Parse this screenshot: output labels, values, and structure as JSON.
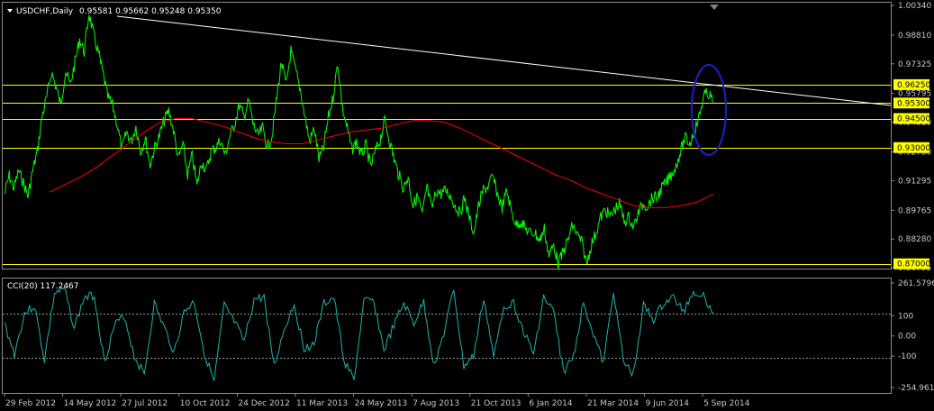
{
  "header": {
    "symbol": "USDCHF,Daily",
    "ohlc": "0.95581 0.95662 0.95248 0.95350"
  },
  "indicator": {
    "label": "CCI(20) 117.2467",
    "ticks": [
      "261.5796",
      "100",
      "0.00",
      "-100",
      "-254.9616"
    ]
  },
  "price_axis": {
    "ticks": [
      "1.00340",
      "0.98810",
      "0.97325",
      "0.95795",
      "0.94310",
      "0.92780",
      "0.91295",
      "0.89765",
      "0.88280",
      "0.86795"
    ],
    "tags": [
      "0.96250",
      "0.95300",
      "0.94500",
      "0.93000",
      "0.87000"
    ]
  },
  "time_axis": {
    "labels": [
      "29 Feb 2012",
      "14 May 2012",
      "27 Jul 2012",
      "10 Oct 2012",
      "24 Dec 2012",
      "11 Mar 2013",
      "24 May 2013",
      "7 Aug 2013",
      "21 Oct 2013",
      "6 Jan 2014",
      "21 Mar 2014",
      "9 Jun 2014",
      "5 Sep 2014"
    ]
  },
  "colors": {
    "background": "#000000",
    "price": "#00ff00",
    "ma": "#ff0000",
    "levels": "#ffff00",
    "trendline": "#ffffff",
    "cci": "#20b2aa",
    "ellipse": "#1e1ecd"
  },
  "chart_data": [
    {
      "type": "line",
      "series": [
        {
          "values": [
            0.906,
            0.9155,
            0.909,
            0.918,
            0.912,
            0.905,
            0.918,
            0.928,
            0.946,
            0.956,
            0.969,
            0.961,
            0.952,
            0.97,
            0.962,
            0.974,
            0.986,
            0.9795,
            0.9995,
            0.988,
            0.979,
            0.968,
            0.956,
            0.952,
            0.942,
            0.929,
            0.938,
            0.933,
            0.941,
            0.928,
            0.935,
            0.921,
            0.93,
            0.936,
            0.944,
            0.949,
            0.939,
            0.924,
            0.932,
            0.916,
            0.926,
            0.91,
            0.923,
            0.918,
            0.928,
            0.93,
            0.934,
            0.926,
            0.936,
            0.942,
            0.952,
            0.946,
            0.954,
            0.942,
            0.936,
            0.94,
            0.93,
            0.936,
            0.956,
            0.974,
            0.962,
            0.98,
            0.97,
            0.96,
            0.946,
            0.933,
            0.94,
            0.924,
            0.93,
            0.946,
            0.956,
            0.974,
            0.95,
            0.94,
            0.929,
            0.933,
            0.926,
            0.931,
            0.92,
            0.928,
            0.934,
            0.944,
            0.934,
            0.924,
            0.916,
            0.909,
            0.915,
            0.9,
            0.905,
            0.895,
            0.91,
            0.898,
            0.908,
            0.906,
            0.908,
            0.905,
            0.9,
            0.896,
            0.904,
            0.894,
            0.886,
            0.9,
            0.908,
            0.91,
            0.915,
            0.906,
            0.899,
            0.908,
            0.897,
            0.89,
            0.892,
            0.888,
            0.886,
            0.886,
            0.882,
            0.888,
            0.874,
            0.88,
            0.87,
            0.876,
            0.882,
            0.89,
            0.885,
            0.881,
            0.87,
            0.88,
            0.886,
            0.894,
            0.898,
            0.894,
            0.898,
            0.901,
            0.892,
            0.894,
            0.889,
            0.896,
            0.901,
            0.9,
            0.904,
            0.904,
            0.909,
            0.912,
            0.916,
            0.92,
            0.928,
            0.935,
            0.932,
            0.939,
            0.946,
            0.957,
            0.958,
            0.9535
          ]
        },
        {
          "values": [
            0.907,
            0.911,
            0.915,
            0.92,
            0.926,
            0.932,
            0.938,
            0.943,
            0.945,
            0.945,
            0.943,
            0.941,
            0.938,
            0.935,
            0.933,
            0.932,
            0.932,
            0.934,
            0.936,
            0.938,
            0.939,
            0.94,
            0.942,
            0.944,
            0.944,
            0.943,
            0.94,
            0.936,
            0.932,
            0.928,
            0.924,
            0.92,
            0.916,
            0.913,
            0.909,
            0.906,
            0.903,
            0.9,
            0.899,
            0.899,
            0.9,
            0.902,
            0.906
          ]
        }
      ],
      "levels": [
        0.9625,
        0.953,
        0.945,
        0.93,
        0.87
      ]
    },
    {
      "type": "line",
      "series": [
        {
          "name": "CCI(20)",
          "values": [
            60,
            -90,
            110,
            150,
            -120,
            210,
            230,
            40,
            190,
            200,
            -130,
            50,
            100,
            -100,
            -190,
            160,
            40,
            -80,
            120,
            170,
            -80,
            -230,
            150,
            70,
            -30,
            180,
            190,
            -150,
            30,
            160,
            -60,
            -40,
            160,
            190,
            -120,
            -220,
            170,
            170,
            -70,
            50,
            160,
            60,
            170,
            -150,
            10,
            230,
            -150,
            -100,
            190,
            -110,
            150,
            160,
            20,
            -90,
            190,
            120,
            -180,
            -100,
            170,
            10,
            -140,
            230,
            -130,
            -190,
            150,
            80,
            160,
            190,
            120,
            220,
            200,
            117
          ]
        }
      ],
      "ylim": [
        -254.9616,
        261.5796
      ]
    }
  ]
}
